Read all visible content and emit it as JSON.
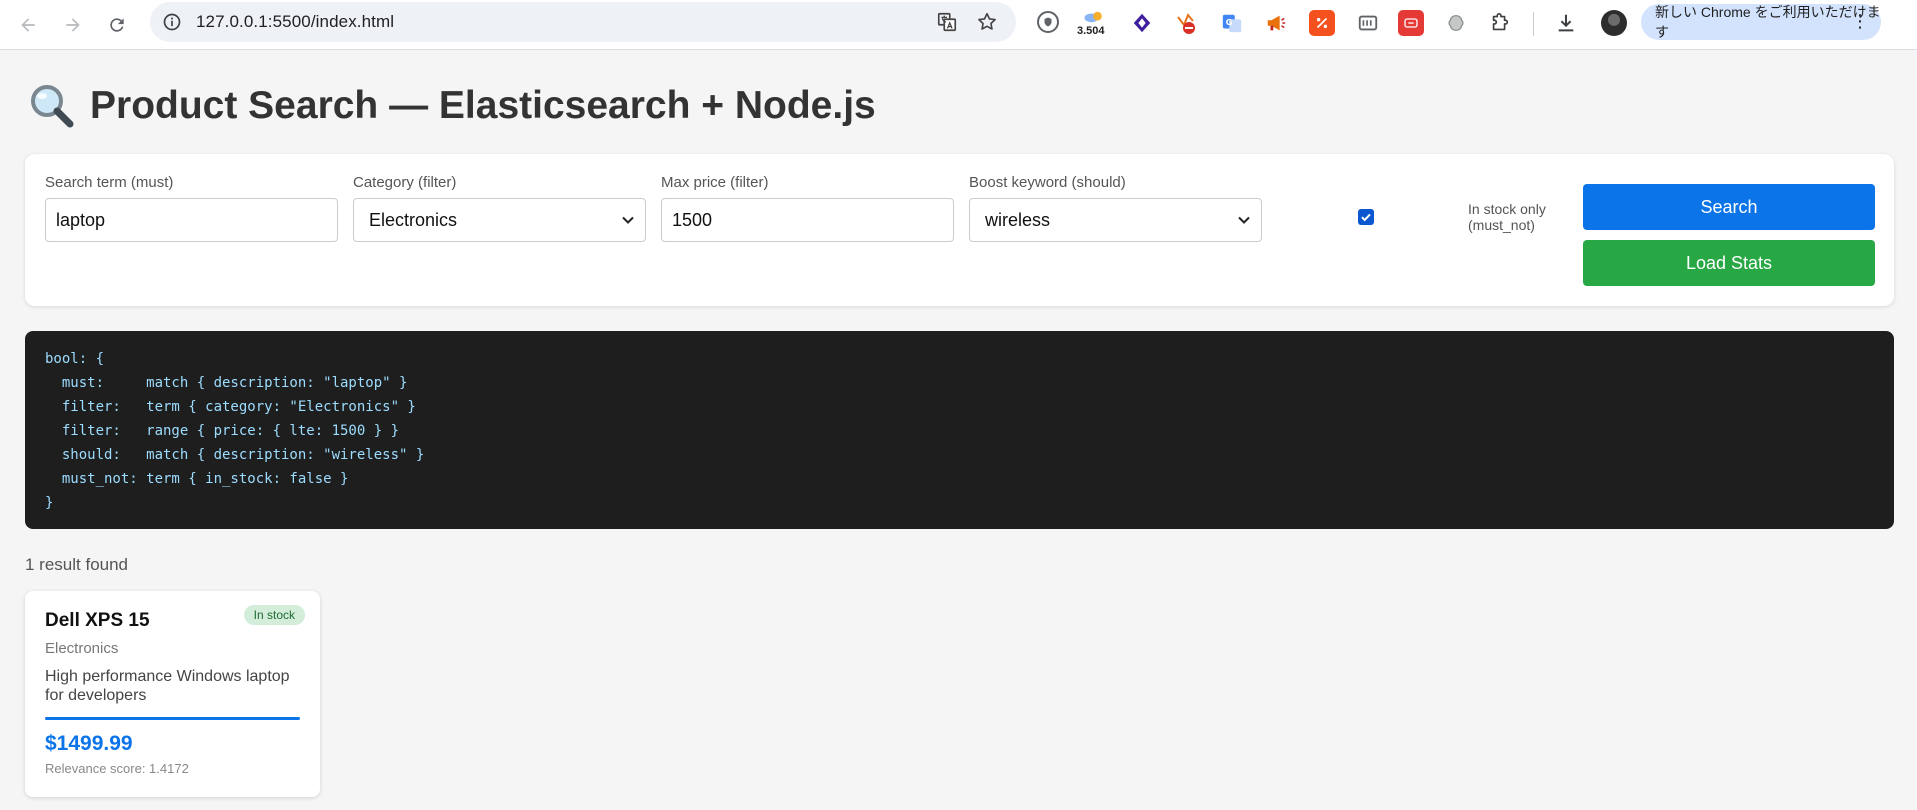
{
  "browser": {
    "url": "127.0.0.1:5500/index.html",
    "extension_badge": "3.504",
    "update_text": "新しい Chrome をご利用いただけます",
    "menu_glyph": "⋮"
  },
  "page": {
    "title": "Product Search — Elasticsearch + Node.js"
  },
  "search": {
    "term_label": "Search term (must)",
    "term_value": "laptop",
    "category_label": "Category (filter)",
    "category_value": "Electronics",
    "max_price_label": "Max price (filter)",
    "max_price_value": "1500",
    "boost_label": "Boost keyword (should)",
    "boost_value": "wireless",
    "in_stock_checked": true,
    "in_stock_label": "In stock only (must_not)",
    "search_button": "Search",
    "stats_button": "Load Stats"
  },
  "query_preview": "bool: {\n  must:     match { description: \"laptop\" }\n  filter:   term { category: \"Electronics\" }\n  filter:   range { price: { lte: 1500 } }\n  should:   match { description: \"wireless\" }\n  must_not: term { in_stock: false }\n}",
  "results": {
    "count_text": "1 result found",
    "items": [
      {
        "name": "Dell XPS 15",
        "badge": "In stock",
        "category": "Electronics",
        "description": "High performance Windows laptop for developers",
        "price": "$1499.99",
        "score": "Relevance score: 1.4172"
      }
    ]
  },
  "colors": {
    "search_button": "#0b74e8",
    "stats_button": "#28a745",
    "query_background": "#1e1e1e",
    "query_text": "#9cdcfe",
    "price": "#0b74e8",
    "badge_background": "#d4edda"
  }
}
